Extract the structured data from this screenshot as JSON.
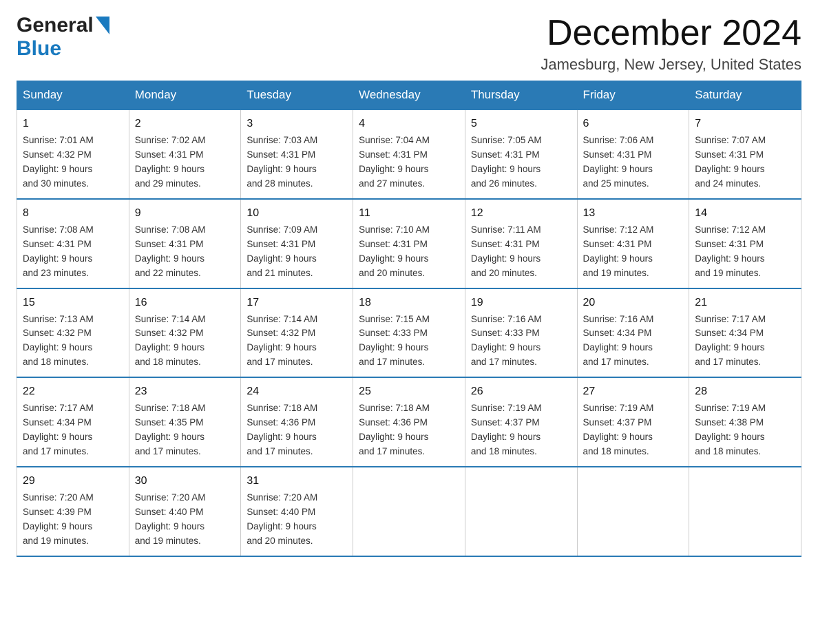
{
  "header": {
    "logo_general": "General",
    "logo_blue": "Blue",
    "title": "December 2024",
    "subtitle": "Jamesburg, New Jersey, United States"
  },
  "days_of_week": [
    "Sunday",
    "Monday",
    "Tuesday",
    "Wednesday",
    "Thursday",
    "Friday",
    "Saturday"
  ],
  "weeks": [
    [
      {
        "day": "1",
        "sunrise": "7:01 AM",
        "sunset": "4:32 PM",
        "daylight": "9 hours and 30 minutes."
      },
      {
        "day": "2",
        "sunrise": "7:02 AM",
        "sunset": "4:31 PM",
        "daylight": "9 hours and 29 minutes."
      },
      {
        "day": "3",
        "sunrise": "7:03 AM",
        "sunset": "4:31 PM",
        "daylight": "9 hours and 28 minutes."
      },
      {
        "day": "4",
        "sunrise": "7:04 AM",
        "sunset": "4:31 PM",
        "daylight": "9 hours and 27 minutes."
      },
      {
        "day": "5",
        "sunrise": "7:05 AM",
        "sunset": "4:31 PM",
        "daylight": "9 hours and 26 minutes."
      },
      {
        "day": "6",
        "sunrise": "7:06 AM",
        "sunset": "4:31 PM",
        "daylight": "9 hours and 25 minutes."
      },
      {
        "day": "7",
        "sunrise": "7:07 AM",
        "sunset": "4:31 PM",
        "daylight": "9 hours and 24 minutes."
      }
    ],
    [
      {
        "day": "8",
        "sunrise": "7:08 AM",
        "sunset": "4:31 PM",
        "daylight": "9 hours and 23 minutes."
      },
      {
        "day": "9",
        "sunrise": "7:08 AM",
        "sunset": "4:31 PM",
        "daylight": "9 hours and 22 minutes."
      },
      {
        "day": "10",
        "sunrise": "7:09 AM",
        "sunset": "4:31 PM",
        "daylight": "9 hours and 21 minutes."
      },
      {
        "day": "11",
        "sunrise": "7:10 AM",
        "sunset": "4:31 PM",
        "daylight": "9 hours and 20 minutes."
      },
      {
        "day": "12",
        "sunrise": "7:11 AM",
        "sunset": "4:31 PM",
        "daylight": "9 hours and 20 minutes."
      },
      {
        "day": "13",
        "sunrise": "7:12 AM",
        "sunset": "4:31 PM",
        "daylight": "9 hours and 19 minutes."
      },
      {
        "day": "14",
        "sunrise": "7:12 AM",
        "sunset": "4:31 PM",
        "daylight": "9 hours and 19 minutes."
      }
    ],
    [
      {
        "day": "15",
        "sunrise": "7:13 AM",
        "sunset": "4:32 PM",
        "daylight": "9 hours and 18 minutes."
      },
      {
        "day": "16",
        "sunrise": "7:14 AM",
        "sunset": "4:32 PM",
        "daylight": "9 hours and 18 minutes."
      },
      {
        "day": "17",
        "sunrise": "7:14 AM",
        "sunset": "4:32 PM",
        "daylight": "9 hours and 17 minutes."
      },
      {
        "day": "18",
        "sunrise": "7:15 AM",
        "sunset": "4:33 PM",
        "daylight": "9 hours and 17 minutes."
      },
      {
        "day": "19",
        "sunrise": "7:16 AM",
        "sunset": "4:33 PM",
        "daylight": "9 hours and 17 minutes."
      },
      {
        "day": "20",
        "sunrise": "7:16 AM",
        "sunset": "4:34 PM",
        "daylight": "9 hours and 17 minutes."
      },
      {
        "day": "21",
        "sunrise": "7:17 AM",
        "sunset": "4:34 PM",
        "daylight": "9 hours and 17 minutes."
      }
    ],
    [
      {
        "day": "22",
        "sunrise": "7:17 AM",
        "sunset": "4:34 PM",
        "daylight": "9 hours and 17 minutes."
      },
      {
        "day": "23",
        "sunrise": "7:18 AM",
        "sunset": "4:35 PM",
        "daylight": "9 hours and 17 minutes."
      },
      {
        "day": "24",
        "sunrise": "7:18 AM",
        "sunset": "4:36 PM",
        "daylight": "9 hours and 17 minutes."
      },
      {
        "day": "25",
        "sunrise": "7:18 AM",
        "sunset": "4:36 PM",
        "daylight": "9 hours and 17 minutes."
      },
      {
        "day": "26",
        "sunrise": "7:19 AM",
        "sunset": "4:37 PM",
        "daylight": "9 hours and 18 minutes."
      },
      {
        "day": "27",
        "sunrise": "7:19 AM",
        "sunset": "4:37 PM",
        "daylight": "9 hours and 18 minutes."
      },
      {
        "day": "28",
        "sunrise": "7:19 AM",
        "sunset": "4:38 PM",
        "daylight": "9 hours and 18 minutes."
      }
    ],
    [
      {
        "day": "29",
        "sunrise": "7:20 AM",
        "sunset": "4:39 PM",
        "daylight": "9 hours and 19 minutes."
      },
      {
        "day": "30",
        "sunrise": "7:20 AM",
        "sunset": "4:40 PM",
        "daylight": "9 hours and 19 minutes."
      },
      {
        "day": "31",
        "sunrise": "7:20 AM",
        "sunset": "4:40 PM",
        "daylight": "9 hours and 20 minutes."
      },
      null,
      null,
      null,
      null
    ]
  ],
  "labels": {
    "sunrise": "Sunrise:",
    "sunset": "Sunset:",
    "daylight": "Daylight:"
  }
}
